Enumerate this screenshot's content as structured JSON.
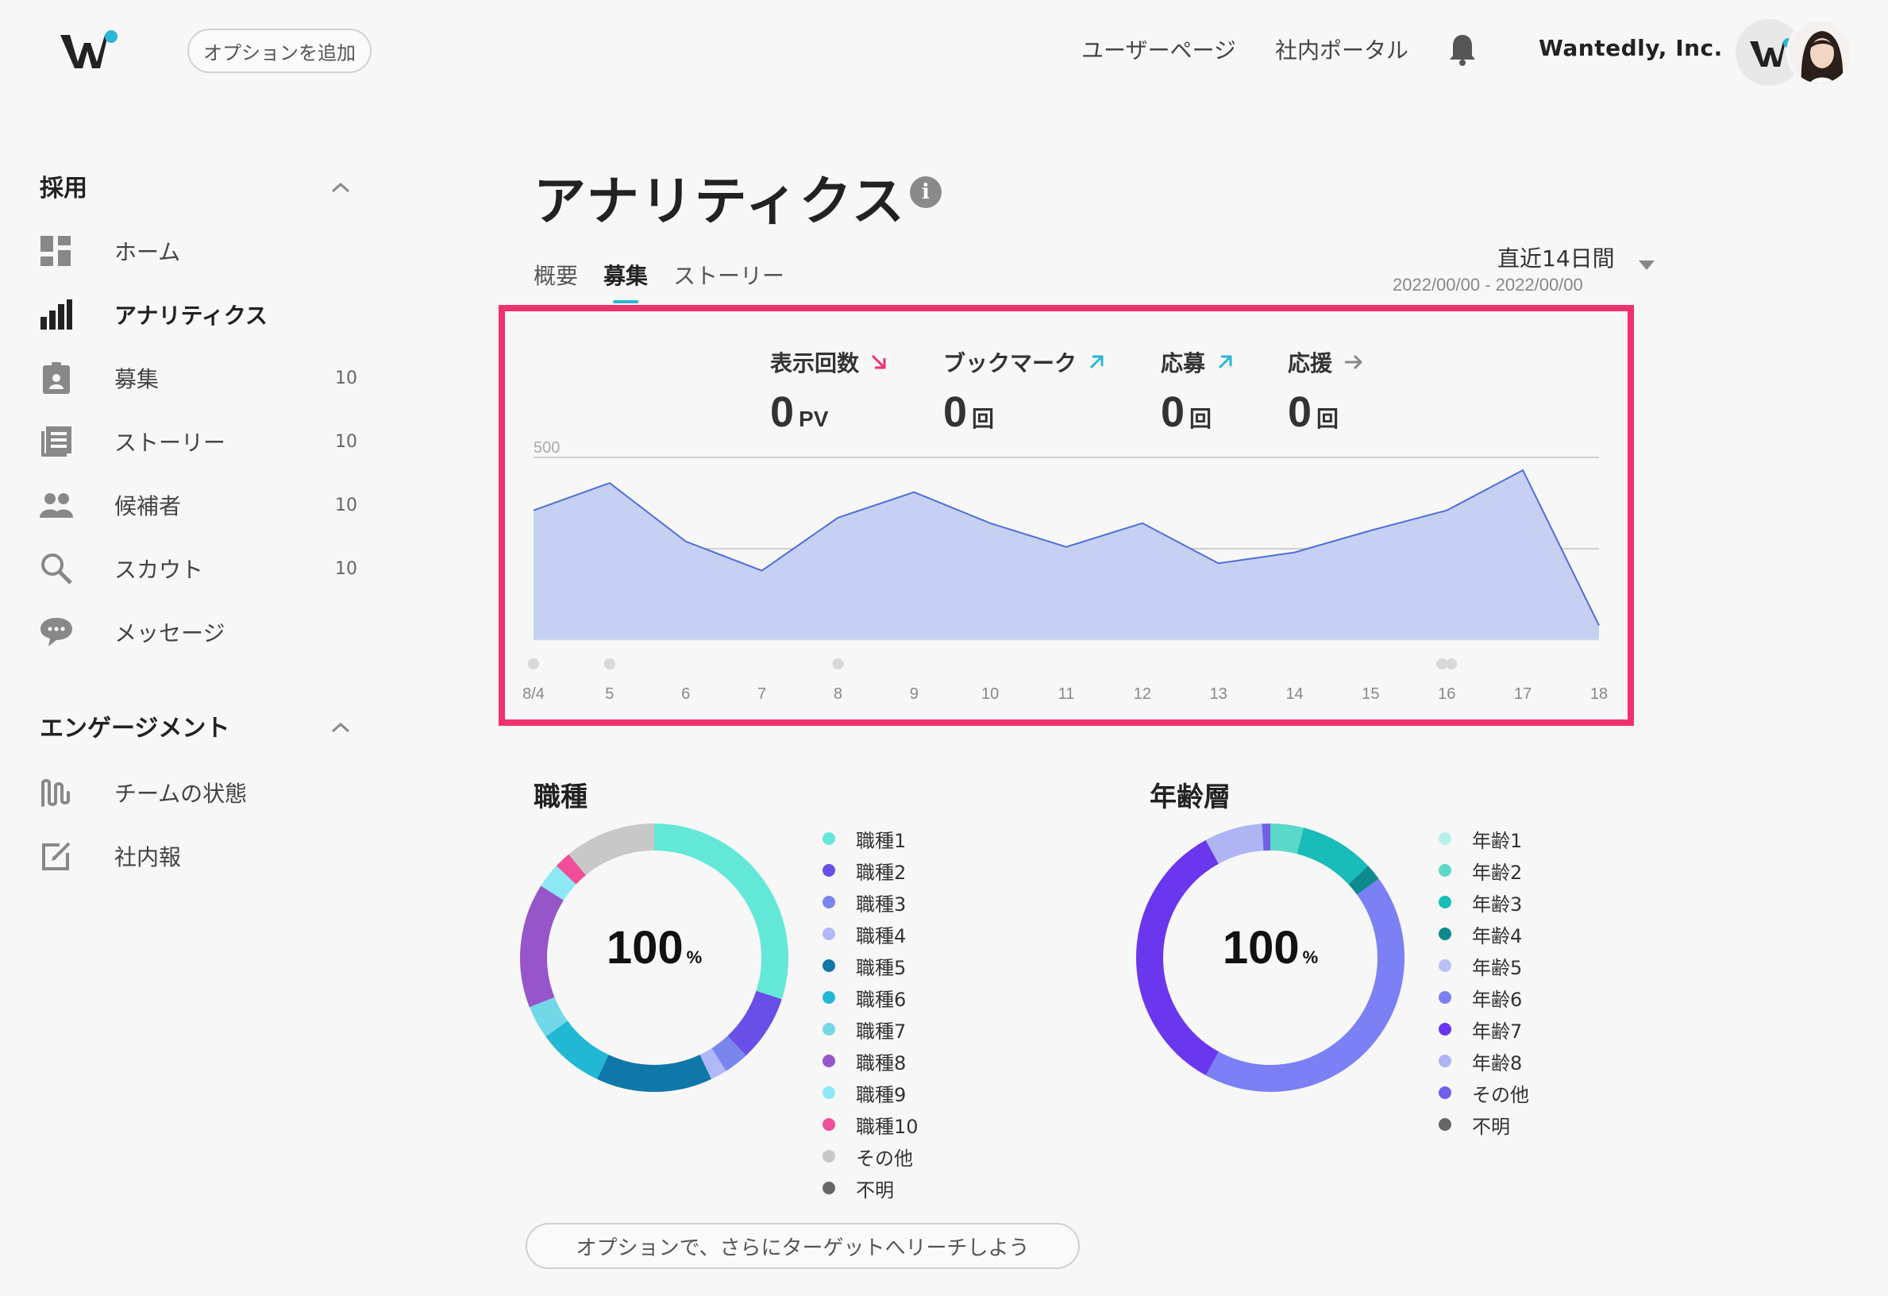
{
  "header": {
    "add_option": "オプションを追加",
    "user_page": "ユーザーページ",
    "portal": "社内ポータル",
    "company": "Wantedly, Inc."
  },
  "sidebar": {
    "section1": "採用",
    "items": [
      {
        "label": "ホーム",
        "count": ""
      },
      {
        "label": "アナリティクス",
        "count": ""
      },
      {
        "label": "募集",
        "count": "10"
      },
      {
        "label": "ストーリー",
        "count": "10"
      },
      {
        "label": "候補者",
        "count": "10"
      },
      {
        "label": "スカウト",
        "count": "10"
      },
      {
        "label": "メッセージ",
        "count": ""
      }
    ],
    "section2": "エンゲージメント",
    "items2": [
      {
        "label": "チームの状態"
      },
      {
        "label": "社内報"
      }
    ]
  },
  "main": {
    "title": "アナリティクス",
    "tabs": [
      "概要",
      "募集",
      "ストーリー"
    ],
    "period": "直近14日間",
    "period_dates": "2022/00/00 - 2022/00/00",
    "metrics": [
      {
        "label": "表示回数",
        "value": "0",
        "unit": "PV",
        "trend": "down",
        "trend_color": "#f0316e"
      },
      {
        "label": "ブックマーク",
        "value": "0",
        "unit": "回",
        "trend": "up",
        "trend_color": "#2ab7d6"
      },
      {
        "label": "応募",
        "value": "0",
        "unit": "回",
        "trend": "up",
        "trend_color": "#2ab7d6"
      },
      {
        "label": "応援",
        "value": "0",
        "unit": "回",
        "trend": "flat",
        "trend_color": "#888888"
      }
    ],
    "bottom_button": "オプションで、さらにターゲットへリーチしよう"
  },
  "chart_data": [
    {
      "type": "area",
      "x": [
        "8/4",
        "5",
        "6",
        "7",
        "8",
        "9",
        "10",
        "11",
        "12",
        "13",
        "14",
        "15",
        "16",
        "17",
        "18"
      ],
      "values": [
        355,
        430,
        270,
        190,
        335,
        405,
        320,
        255,
        320,
        210,
        240,
        300,
        355,
        465,
        40
      ],
      "ylim": [
        0,
        500
      ],
      "yticks": [
        "500",
        "250"
      ],
      "event_markers_at": [
        "8/4",
        "5",
        "8",
        "16",
        "16"
      ],
      "color": "#4f6fd8",
      "fill": "#c6d0f3",
      "grid": true
    },
    {
      "type": "pie",
      "title": "職種",
      "center_label": "100",
      "center_unit": "%",
      "labels": [
        "職種1",
        "職種2",
        "職種3",
        "職種4",
        "職種5",
        "職種6",
        "職種7",
        "職種8",
        "職種9",
        "職種10",
        "その他",
        "不明"
      ],
      "colors": [
        "#63e8d8",
        "#6a4ee8",
        "#7b85ee",
        "#b0b8f5",
        "#0f78a8",
        "#22b8d4",
        "#72d8e8",
        "#9655c8",
        "#8ce8f5",
        "#f04e98",
        "#c8c8c8",
        "#666666"
      ],
      "values": [
        30,
        8,
        3,
        2,
        14,
        8,
        4,
        15,
        3,
        2,
        11,
        0
      ]
    },
    {
      "type": "pie",
      "title": "年齢層",
      "center_label": "100",
      "center_unit": "%",
      "labels": [
        "年齢1",
        "年齢2",
        "年齢3",
        "年齢4",
        "年齢5",
        "年齢6",
        "年齢7",
        "年齢8",
        "その他",
        "不明"
      ],
      "colors": [
        "#b8f0e8",
        "#5ad8c8",
        "#18bcb8",
        "#0e8a8e",
        "#b8c0f5",
        "#7b80f5",
        "#6a36ee",
        "#aeb5f2",
        "#7060e8",
        "#666666"
      ],
      "values": [
        0,
        4,
        9,
        2,
        0,
        43,
        34,
        7,
        1,
        0
      ]
    }
  ]
}
